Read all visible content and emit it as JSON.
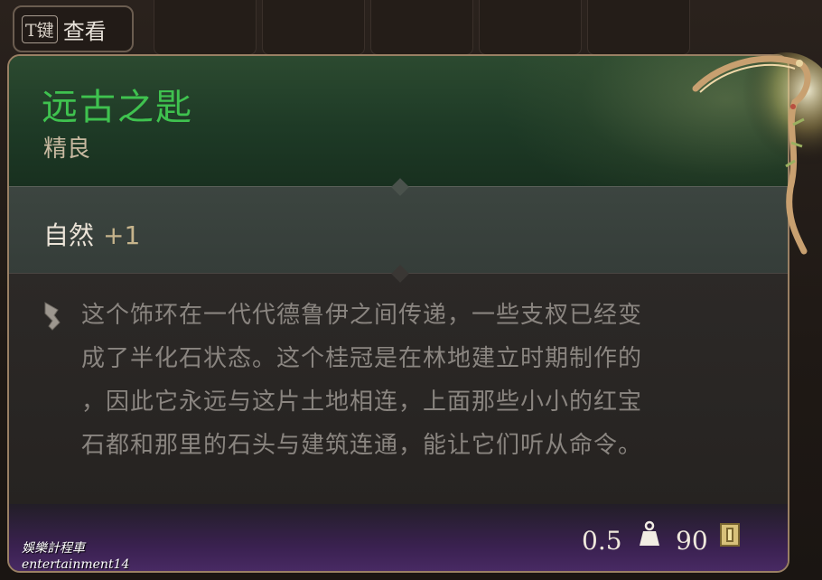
{
  "hint": {
    "key": "T键",
    "label": "查看"
  },
  "item": {
    "name": "远古之匙",
    "rarity": "精良",
    "stat_name": "自然",
    "stat_value": "+1",
    "description": "这个饰环在一代代德鲁伊之间传递，一些支杈已经变\n成了半化石状态。这个桂冠是在林地建立时期制作的\n，因此它永远与这片土地相连，上面那些小小的红宝\n石都和那里的石头与建筑连通，能让它们听从命令。",
    "weight": "0.5",
    "value": "90"
  },
  "watermark": {
    "line1": "娛樂計程車",
    "line2": "entertainment14"
  },
  "colors": {
    "name": "#3fc24f",
    "rarity": "#c8b9a0",
    "stat_value": "#c6b48c",
    "description": "#8a8580",
    "border": "#9a8064"
  },
  "icons": [
    "quill-icon",
    "weight-icon",
    "gold-coin-icon",
    "circlet-item-icon"
  ]
}
